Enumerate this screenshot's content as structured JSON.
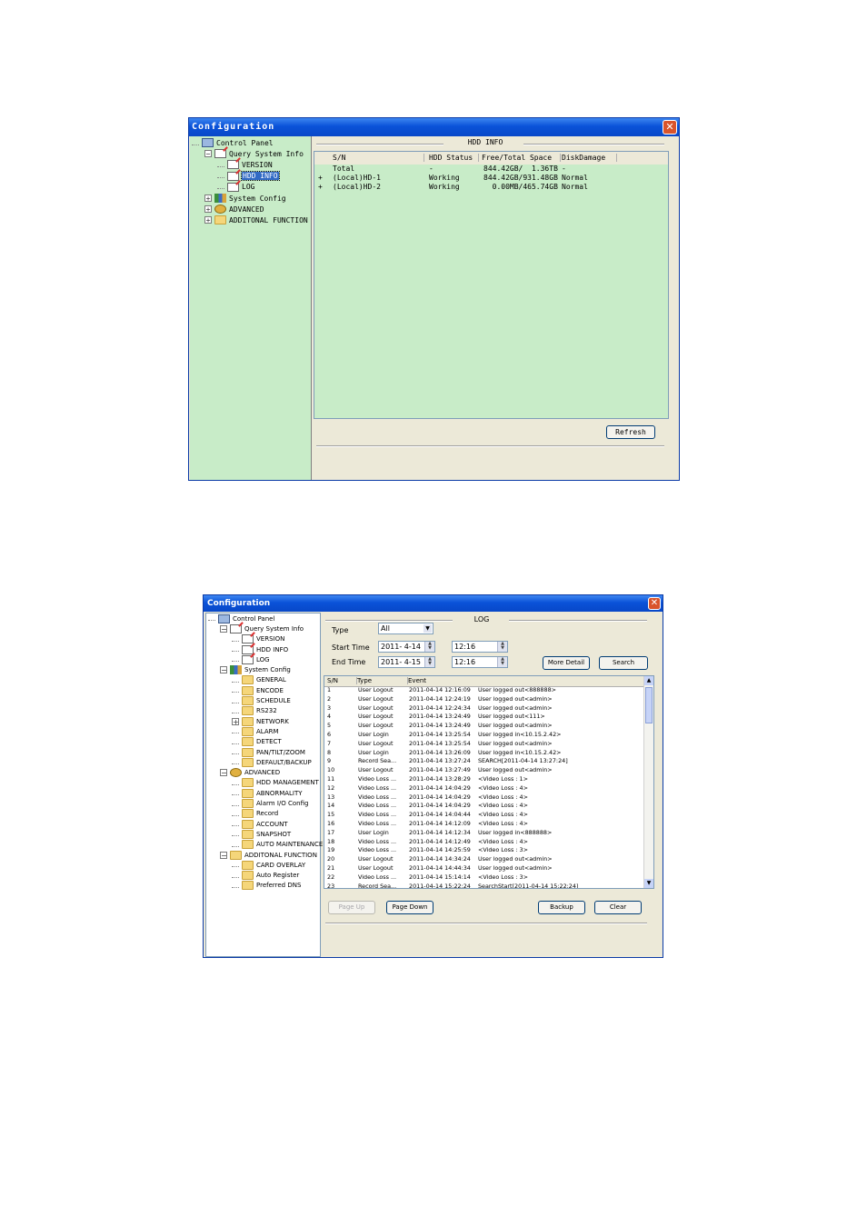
{
  "window1": {
    "title": "Configuration",
    "tree": [
      {
        "label": "Control Panel",
        "icon": "computer-icon",
        "level": 0,
        "expander": ""
      },
      {
        "label": "Query System Info",
        "icon": "document-edit-icon",
        "level": 1,
        "expander": "-"
      },
      {
        "label": "VERSION",
        "icon": "document-edit-icon",
        "level": 2,
        "expander": ""
      },
      {
        "label": "HDD INFO",
        "icon": "document-edit-icon",
        "level": 2,
        "expander": "",
        "selected": true
      },
      {
        "label": "LOG",
        "icon": "document-edit-icon",
        "level": 2,
        "expander": ""
      },
      {
        "label": "System Config",
        "icon": "config-icon",
        "level": 1,
        "expander": "+"
      },
      {
        "label": "ADVANCED",
        "icon": "advanced-icon",
        "level": 1,
        "expander": "+"
      },
      {
        "label": "ADDITONAL FUNCTION",
        "icon": "folder-icon",
        "level": 1,
        "expander": "+"
      }
    ],
    "section_title": "HDD INFO",
    "columns": [
      "S/N",
      "HDD Status",
      "Free/Total Space",
      "DiskDamage"
    ],
    "rows": [
      {
        "mark": "",
        "sn": "Total",
        "status": "-",
        "space": "844.42GB/  1.36TB",
        "damage": "-"
      },
      {
        "mark": "+",
        "sn": "(Local)HD-1",
        "status": "Working",
        "space": "844.42GB/931.48GB",
        "damage": "Normal"
      },
      {
        "mark": "+",
        "sn": "(Local)HD-2",
        "status": "Working",
        "space": "  0.00MB/465.74GB",
        "damage": "Normal"
      }
    ],
    "refresh_label": "Refresh",
    "colors": {
      "panel_bg": "#c8ecc8",
      "title": "#0a52d8"
    }
  },
  "window2": {
    "title": "Configuration",
    "tree": [
      {
        "label": "Control Panel",
        "icon": "computer-icon",
        "level": 0,
        "expander": ""
      },
      {
        "label": "Query System Info",
        "icon": "document-edit-icon",
        "level": 1,
        "expander": "-"
      },
      {
        "label": "VERSION",
        "icon": "document-edit-icon",
        "level": 2,
        "expander": ""
      },
      {
        "label": "HDD INFO",
        "icon": "document-edit-icon",
        "level": 2,
        "expander": ""
      },
      {
        "label": "LOG",
        "icon": "document-edit-icon",
        "level": 2,
        "expander": ""
      },
      {
        "label": "System Config",
        "icon": "config-icon",
        "level": 1,
        "expander": "-"
      },
      {
        "label": "GENERAL",
        "icon": "folder-icon",
        "level": 2,
        "expander": ""
      },
      {
        "label": "ENCODE",
        "icon": "folder-icon",
        "level": 2,
        "expander": ""
      },
      {
        "label": "SCHEDULE",
        "icon": "folder-icon",
        "level": 2,
        "expander": ""
      },
      {
        "label": "RS232",
        "icon": "folder-icon",
        "level": 2,
        "expander": ""
      },
      {
        "label": "NETWORK",
        "icon": "folder-icon",
        "level": 2,
        "expander": "+"
      },
      {
        "label": "ALARM",
        "icon": "folder-icon",
        "level": 2,
        "expander": ""
      },
      {
        "label": "DETECT",
        "icon": "folder-icon",
        "level": 2,
        "expander": ""
      },
      {
        "label": "PAN/TILT/ZOOM",
        "icon": "folder-icon",
        "level": 2,
        "expander": ""
      },
      {
        "label": "DEFAULT/BACKUP",
        "icon": "folder-icon",
        "level": 2,
        "expander": ""
      },
      {
        "label": "ADVANCED",
        "icon": "advanced-icon",
        "level": 1,
        "expander": "-"
      },
      {
        "label": "HDD MANAGEMENT",
        "icon": "folder-icon",
        "level": 2,
        "expander": ""
      },
      {
        "label": "ABNORMALITY",
        "icon": "folder-icon",
        "level": 2,
        "expander": ""
      },
      {
        "label": "Alarm I/O Config",
        "icon": "folder-icon",
        "level": 2,
        "expander": ""
      },
      {
        "label": "Record",
        "icon": "folder-icon",
        "level": 2,
        "expander": ""
      },
      {
        "label": "ACCOUNT",
        "icon": "folder-icon",
        "level": 2,
        "expander": ""
      },
      {
        "label": "SNAPSHOT",
        "icon": "folder-icon",
        "level": 2,
        "expander": ""
      },
      {
        "label": "AUTO MAINTENANCE",
        "icon": "folder-icon",
        "level": 2,
        "expander": ""
      },
      {
        "label": "ADDITONAL FUNCTION",
        "icon": "folder-icon",
        "level": 1,
        "expander": "-"
      },
      {
        "label": "CARD OVERLAY",
        "icon": "folder-icon",
        "level": 2,
        "expander": ""
      },
      {
        "label": "Auto Register",
        "icon": "folder-icon",
        "level": 2,
        "expander": ""
      },
      {
        "label": "Preferred DNS",
        "icon": "folder-icon",
        "level": 2,
        "expander": ""
      }
    ],
    "section_title": "LOG",
    "type_label": "Type",
    "type_value": "All",
    "start_label": "Start Time",
    "start_date": "2011- 4-14",
    "start_time": "12:16",
    "end_label": "End Time",
    "end_date": "2011- 4-15",
    "end_time": "12:16",
    "more_detail_label": "More Detail",
    "search_label": "Search",
    "columns": [
      "S/N",
      "Type",
      "Event"
    ],
    "rows": [
      {
        "sn": "1",
        "type": "User Logout",
        "time": "2011-04-14 12:16:09",
        "event": "User logged out<888888>"
      },
      {
        "sn": "2",
        "type": "User Logout",
        "time": "2011-04-14 12:24:19",
        "event": "User logged out<admin>"
      },
      {
        "sn": "3",
        "type": "User Logout",
        "time": "2011-04-14 12:24:34",
        "event": "User logged out<admin>"
      },
      {
        "sn": "4",
        "type": "User Logout",
        "time": "2011-04-14 13:24:49",
        "event": "User logged out<111>"
      },
      {
        "sn": "5",
        "type": "User Logout",
        "time": "2011-04-14 13:24:49",
        "event": "User logged out<admin>"
      },
      {
        "sn": "6",
        "type": "User Login",
        "time": "2011-04-14 13:25:54",
        "event": "User logged in<10.15.2.42>"
      },
      {
        "sn": "7",
        "type": "User Logout",
        "time": "2011-04-14 13:25:54",
        "event": "User logged out<admin>"
      },
      {
        "sn": "8",
        "type": "User Login",
        "time": "2011-04-14 13:26:09",
        "event": "User logged in<10.15.2.42>"
      },
      {
        "sn": "9",
        "type": "Record Sea...",
        "time": "2011-04-14 13:27:24",
        "event": "SEARCH[2011-04-14 13:27:24]"
      },
      {
        "sn": "10",
        "type": "User Logout",
        "time": "2011-04-14 13:27:49",
        "event": "User logged out<admin>"
      },
      {
        "sn": "11",
        "type": "Video Loss ...",
        "time": "2011-04-14 13:28:29",
        "event": "<Video Loss : 1>"
      },
      {
        "sn": "12",
        "type": "Video Loss ...",
        "time": "2011-04-14 14:04:29",
        "event": "<Video Loss : 4>"
      },
      {
        "sn": "13",
        "type": "Video Loss ...",
        "time": "2011-04-14 14:04:29",
        "event": "<Video Loss : 4>"
      },
      {
        "sn": "14",
        "type": "Video Loss ...",
        "time": "2011-04-14 14:04:29",
        "event": "<Video Loss : 4>"
      },
      {
        "sn": "15",
        "type": "Video Loss ...",
        "time": "2011-04-14 14:04:44",
        "event": "<Video Loss : 4>"
      },
      {
        "sn": "16",
        "type": "Video Loss ...",
        "time": "2011-04-14 14:12:09",
        "event": "<Video Loss : 4>"
      },
      {
        "sn": "17",
        "type": "User Login",
        "time": "2011-04-14 14:12:34",
        "event": "User logged in<888888>"
      },
      {
        "sn": "18",
        "type": "Video Loss ...",
        "time": "2011-04-14 14:12:49",
        "event": "<Video Loss : 4>"
      },
      {
        "sn": "19",
        "type": "Video Loss ...",
        "time": "2011-04-14 14:25:59",
        "event": "<Video Loss : 3>"
      },
      {
        "sn": "20",
        "type": "User Logout",
        "time": "2011-04-14 14:34:24",
        "event": "User logged out<admin>"
      },
      {
        "sn": "21",
        "type": "User Logout",
        "time": "2011-04-14 14:44:34",
        "event": "User logged out<admin>"
      },
      {
        "sn": "22",
        "type": "Video Loss ...",
        "time": "2011-04-14 15:14:14",
        "event": "<Video Loss : 3>"
      },
      {
        "sn": "23",
        "type": "Record Sea...",
        "time": "2011-04-14 15:22:24",
        "event": "SearchStart[2011-04-14 15:22:24]"
      }
    ],
    "page_up_label": "Page Up",
    "page_down_label": "Page Down",
    "backup_label": "Backup",
    "clear_label": "Clear"
  }
}
